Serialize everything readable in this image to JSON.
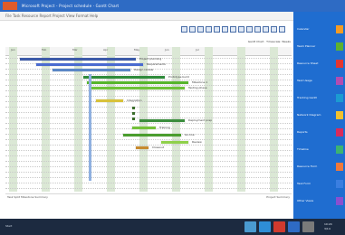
{
  "window": {
    "title": "Microsoft Project - Project schedule · Gantt Chart",
    "menu": "File   Task   Resource   Report   Project   View   Format   Help"
  },
  "toolbar": {
    "icons": [
      "align-left-icon",
      "align-center-icon",
      "align-right-icon",
      "indent-icon",
      "outdent-icon",
      "link-icon",
      "unlink-icon",
      "zoom-in-icon",
      "zoom-out-icon",
      "scroll-to-task-icon",
      "arrow-left-icon",
      "arrow-right-icon",
      "more-icon"
    ]
  },
  "view_label": "Gantt Chart · Timescale: Weeks",
  "gantt": {
    "timescale_header": [
      "Jan",
      "Feb",
      "Mar",
      "Apr",
      "May",
      "Jun",
      "Jul"
    ],
    "tasks": [
      {
        "label": "Project planning",
        "color": "#3c5aa8"
      },
      {
        "label": "Requirements",
        "color": "#4a6bd0"
      },
      {
        "label": "Design review",
        "color": "#5a87c6"
      },
      {
        "label": "Prototype build",
        "color": "#2e8b3a"
      },
      {
        "label": "Milestone 1",
        "color": "#56b52b"
      },
      {
        "label": "Testing phase",
        "color": "#6fc23a"
      },
      {
        "label": "Integration",
        "color": "#d8c23a"
      },
      {
        "label": "Deployment prep",
        "color": "#3a8d3c"
      },
      {
        "label": "Training",
        "color": "#74c23a"
      },
      {
        "label": "Go-live",
        "color": "#4a9d2e"
      },
      {
        "label": "Review",
        "color": "#8fd04a"
      },
      {
        "label": "Closeout",
        "color": "#c78b2f"
      }
    ],
    "legend_left": "Task   Split   Milestone   Summary",
    "legend_right": "Project Summary"
  },
  "right_pane": {
    "items": [
      {
        "label": "Calendar",
        "tile": "#f59b23"
      },
      {
        "label": "Team Planner",
        "tile": "#5db12f"
      },
      {
        "label": "Resource Sheet",
        "tile": "#e4352f"
      },
      {
        "label": "Task Usage",
        "tile": "#b24cb1"
      },
      {
        "label": "Tracking Gantt",
        "tile": "#1b9bd1"
      },
      {
        "label": "Network Diagram",
        "tile": "#f2c12e"
      },
      {
        "label": "Reports",
        "tile": "#d92b5b"
      },
      {
        "label": "Timeline",
        "tile": "#3cb371"
      },
      {
        "label": "Resource Form",
        "tile": "#f0783a"
      },
      {
        "label": "Task Form",
        "tile": "#3a7ee0"
      },
      {
        "label": "Other Views",
        "tile": "#8a4fd0"
      }
    ]
  },
  "taskbar": {
    "start_label": "Start",
    "tray_time": "10:24",
    "tray_date": "3/14",
    "apps": [
      {
        "name": "explorer",
        "color": "#4a9ad0"
      },
      {
        "name": "browser",
        "color": "#2e8dd6"
      },
      {
        "name": "mail",
        "color": "#d03a2e"
      },
      {
        "name": "project",
        "color": "#2e6bc4"
      },
      {
        "name": "store",
        "color": "#7a7a7a"
      }
    ]
  }
}
